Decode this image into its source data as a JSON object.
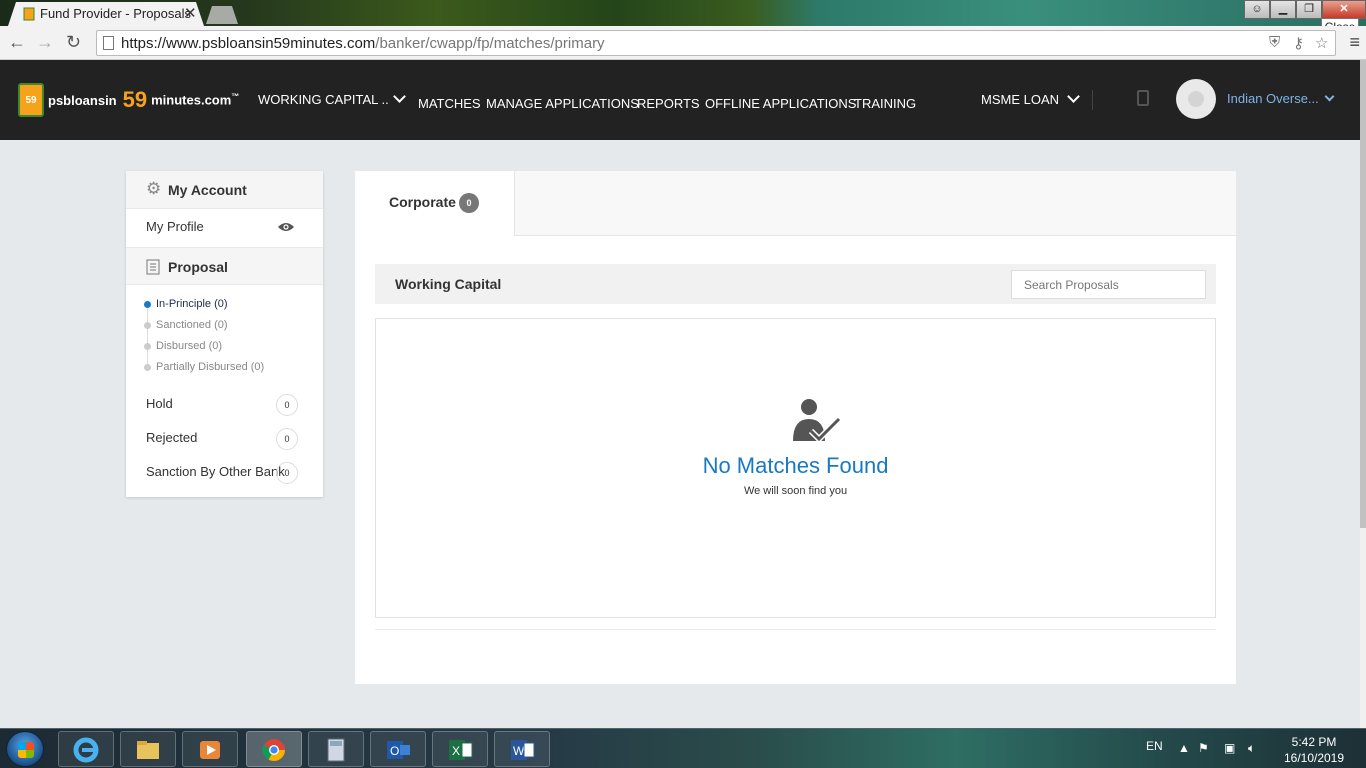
{
  "browser": {
    "tab_title": "Fund Provider - Proposals",
    "tab_close": "✕",
    "tooltip": "Close",
    "url_host": "https://www.psbloansin59minutes.com",
    "url_path": "/banker/cwapp/fp/matches/primary"
  },
  "logo": {
    "part1": "psbloansin",
    "part2": "59",
    "part3": "minutes.com",
    "tm": "™",
    "badge": "59"
  },
  "nav": {
    "product": "WORKING CAPITAL ..",
    "items": [
      "MATCHES",
      "MANAGE APPLICATIONS",
      "REPORTS",
      "OFFLINE APPLICATIONS",
      "TRAINING"
    ],
    "loan_type": "MSME LOAN",
    "user": "Indian Overse..."
  },
  "sidebar": {
    "account_title": "My Account",
    "profile": "My Profile",
    "proposal_title": "Proposal",
    "steps": [
      "In-Principle (0)",
      "Sanctioned (0)",
      "Disbursed (0)",
      "Partially Disbursed (0)"
    ],
    "hold": "Hold",
    "hold_count": "0",
    "rejected": "Rejected",
    "rejected_count": "0",
    "other_bank": "Sanction By Other Bank",
    "other_bank_count": "0"
  },
  "main": {
    "tab_label": "Corporate",
    "tab_count": "0",
    "section_title": "Working Capital",
    "search_placeholder": "Search Proposals",
    "empty_title": "No Matches Found",
    "empty_subtitle": "We will soon find you"
  },
  "taskbar": {
    "lang": "EN",
    "time": "5:42 PM",
    "date": "16/10/2019"
  },
  "colors": {
    "accent": "#1779c4",
    "logo_orange": "#f7a21b",
    "navbar": "#222222"
  }
}
